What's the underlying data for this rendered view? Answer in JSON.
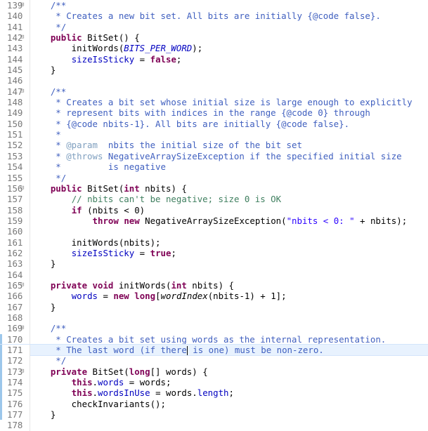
{
  "editor": {
    "lines": [
      {
        "n": "139",
        "fold": true,
        "tokens": [
          {
            "t": "    "
          },
          {
            "t": "/**",
            "c": "cm"
          }
        ]
      },
      {
        "n": "140",
        "tokens": [
          {
            "t": "     * Creates a new bit set. All bits are initially {@code false}.",
            "c": "cm"
          }
        ]
      },
      {
        "n": "141",
        "tokens": [
          {
            "t": "     */",
            "c": "cm"
          }
        ]
      },
      {
        "n": "142",
        "fold": true,
        "tokens": [
          {
            "t": "    "
          },
          {
            "t": "public",
            "c": "kw"
          },
          {
            "t": " BitSet() {"
          }
        ]
      },
      {
        "n": "143",
        "tokens": [
          {
            "t": "        initWords("
          },
          {
            "t": "BITS_PER_WORD",
            "c": "stat"
          },
          {
            "t": ");"
          }
        ]
      },
      {
        "n": "144",
        "tokens": [
          {
            "t": "        "
          },
          {
            "t": "sizeIsSticky",
            "c": "fld"
          },
          {
            "t": " = "
          },
          {
            "t": "false",
            "c": "kw"
          },
          {
            "t": ";"
          }
        ]
      },
      {
        "n": "145",
        "tokens": [
          {
            "t": "    }"
          }
        ]
      },
      {
        "n": "146",
        "tokens": []
      },
      {
        "n": "147",
        "fold": true,
        "tokens": [
          {
            "t": "    "
          },
          {
            "t": "/**",
            "c": "cm"
          }
        ]
      },
      {
        "n": "148",
        "tokens": [
          {
            "t": "     * Creates a bit set whose initial size is large enough to explicitly",
            "c": "cm"
          }
        ]
      },
      {
        "n": "149",
        "tokens": [
          {
            "t": "     * represent bits with indices in the range {@code 0} through",
            "c": "cm"
          }
        ]
      },
      {
        "n": "150",
        "tokens": [
          {
            "t": "     * {@code nbits-1}. All bits are initially {@code false}.",
            "c": "cm"
          }
        ]
      },
      {
        "n": "151",
        "tokens": [
          {
            "t": "     *",
            "c": "cm"
          }
        ]
      },
      {
        "n": "152",
        "tokens": [
          {
            "t": "     * ",
            "c": "cm"
          },
          {
            "t": "@param",
            "c": "cm-tag"
          },
          {
            "t": "  nbits the initial size of the bit set",
            "c": "cm"
          }
        ]
      },
      {
        "n": "153",
        "tokens": [
          {
            "t": "     * ",
            "c": "cm"
          },
          {
            "t": "@throws",
            "c": "cm-tag"
          },
          {
            "t": " NegativeArraySizeException if the specified initial size",
            "c": "cm"
          }
        ]
      },
      {
        "n": "154",
        "tokens": [
          {
            "t": "     *         is negative",
            "c": "cm"
          }
        ]
      },
      {
        "n": "155",
        "tokens": [
          {
            "t": "     */",
            "c": "cm"
          }
        ]
      },
      {
        "n": "156",
        "fold": true,
        "tokens": [
          {
            "t": "    "
          },
          {
            "t": "public",
            "c": "kw"
          },
          {
            "t": " BitSet("
          },
          {
            "t": "int",
            "c": "kw"
          },
          {
            "t": " nbits) {"
          }
        ]
      },
      {
        "n": "157",
        "tokens": [
          {
            "t": "        "
          },
          {
            "t": "// nbits can't be negative; size 0 is OK",
            "c": "lc"
          }
        ]
      },
      {
        "n": "158",
        "tokens": [
          {
            "t": "        "
          },
          {
            "t": "if",
            "c": "kw"
          },
          {
            "t": " (nbits < 0)"
          }
        ]
      },
      {
        "n": "159",
        "tokens": [
          {
            "t": "            "
          },
          {
            "t": "throw",
            "c": "kw"
          },
          {
            "t": " "
          },
          {
            "t": "new",
            "c": "kw"
          },
          {
            "t": " NegativeArraySizeException("
          },
          {
            "t": "\"nbits < 0: \"",
            "c": "str"
          },
          {
            "t": " + nbits);"
          }
        ]
      },
      {
        "n": "160",
        "tokens": []
      },
      {
        "n": "161",
        "tokens": [
          {
            "t": "        initWords(nbits);"
          }
        ]
      },
      {
        "n": "162",
        "tokens": [
          {
            "t": "        "
          },
          {
            "t": "sizeIsSticky",
            "c": "fld"
          },
          {
            "t": " = "
          },
          {
            "t": "true",
            "c": "kw"
          },
          {
            "t": ";"
          }
        ]
      },
      {
        "n": "163",
        "tokens": [
          {
            "t": "    }"
          }
        ]
      },
      {
        "n": "164",
        "tokens": []
      },
      {
        "n": "165",
        "fold": true,
        "tokens": [
          {
            "t": "    "
          },
          {
            "t": "private",
            "c": "kw"
          },
          {
            "t": " "
          },
          {
            "t": "void",
            "c": "kw"
          },
          {
            "t": " initWords("
          },
          {
            "t": "int",
            "c": "kw"
          },
          {
            "t": " nbits) {"
          }
        ]
      },
      {
        "n": "166",
        "tokens": [
          {
            "t": "        "
          },
          {
            "t": "words",
            "c": "fld"
          },
          {
            "t": " = "
          },
          {
            "t": "new",
            "c": "kw"
          },
          {
            "t": " "
          },
          {
            "t": "long",
            "c": "kw"
          },
          {
            "t": "["
          },
          {
            "t": "wordIndex",
            "c": "mth"
          },
          {
            "t": "(nbits-1) + 1];"
          }
        ]
      },
      {
        "n": "167",
        "tokens": [
          {
            "t": "    }"
          }
        ]
      },
      {
        "n": "168",
        "tokens": []
      },
      {
        "n": "169",
        "fold": true,
        "tokens": [
          {
            "t": "    "
          },
          {
            "t": "/**",
            "c": "cm"
          }
        ]
      },
      {
        "n": "170",
        "changed": true,
        "tokens": [
          {
            "t": "     * Creates a bit set using words as the internal representation.",
            "c": "cm"
          }
        ]
      },
      {
        "n": "171",
        "changed": true,
        "current": true,
        "tokens": [
          {
            "t": "     * The last word (if there",
            "c": "cm"
          },
          {
            "caret": true
          },
          {
            "t": " is one) must be non-zero.",
            "c": "cm"
          }
        ]
      },
      {
        "n": "172",
        "changed": true,
        "tokens": [
          {
            "t": "     */",
            "c": "cm"
          }
        ]
      },
      {
        "n": "173",
        "fold": true,
        "changed": true,
        "tokens": [
          {
            "t": "    "
          },
          {
            "t": "private",
            "c": "kw"
          },
          {
            "t": " BitSet("
          },
          {
            "t": "long",
            "c": "kw"
          },
          {
            "t": "[] words) {"
          }
        ]
      },
      {
        "n": "174",
        "changed": true,
        "tokens": [
          {
            "t": "        "
          },
          {
            "t": "this",
            "c": "kw"
          },
          {
            "t": "."
          },
          {
            "t": "words",
            "c": "fld"
          },
          {
            "t": " = words;"
          }
        ]
      },
      {
        "n": "175",
        "changed": true,
        "tokens": [
          {
            "t": "        "
          },
          {
            "t": "this",
            "c": "kw"
          },
          {
            "t": "."
          },
          {
            "t": "wordsInUse",
            "c": "fld"
          },
          {
            "t": " = words."
          },
          {
            "t": "length",
            "c": "fld"
          },
          {
            "t": ";"
          }
        ]
      },
      {
        "n": "176",
        "changed": true,
        "tokens": [
          {
            "t": "        checkInvariants();"
          }
        ]
      },
      {
        "n": "177",
        "changed": true,
        "tokens": [
          {
            "t": "    }"
          }
        ]
      },
      {
        "n": "178",
        "tokens": []
      }
    ]
  }
}
